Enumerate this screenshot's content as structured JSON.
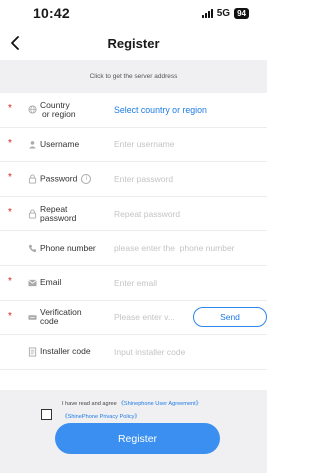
{
  "status_bar": {
    "time": "10:42",
    "network": "5G",
    "battery": "94"
  },
  "nav": {
    "title": "Register"
  },
  "server_hint": "Click to get the server address",
  "form": {
    "country": {
      "label_line1": "Country",
      "label_line2": "or region",
      "value": "Select country or region",
      "required": "*"
    },
    "username": {
      "label": "Username",
      "placeholder": "Enter username",
      "required": "*"
    },
    "password": {
      "label": "Password",
      "placeholder": "Enter password",
      "required": "*",
      "info": "i"
    },
    "repeat_password": {
      "label_line1": "Repeat",
      "label_line2": "password",
      "placeholder": "Repeat password",
      "required": "*"
    },
    "phone": {
      "label": "Phone number",
      "placeholder": "please enter the  phone number"
    },
    "email": {
      "label": "Email",
      "placeholder": "Enter email",
      "required": "*"
    },
    "verification": {
      "label_line1": "Verification",
      "label_line2": "code",
      "placeholder": "Please enter v...",
      "required": "*",
      "send_label": "Send"
    },
    "installer": {
      "label": "Installer code",
      "placeholder": "Input installer code"
    }
  },
  "agreement": {
    "prefix": "I have read and agree ",
    "user_agreement": "《Shinephone User Agreement》",
    "privacy_policy": "《ShinePhone Privacy Policy》"
  },
  "register_button": "Register",
  "colors": {
    "accent": "#3b8ff0",
    "link": "#1e7be6",
    "required": "#e02020",
    "strip": "#f0f0f2"
  }
}
